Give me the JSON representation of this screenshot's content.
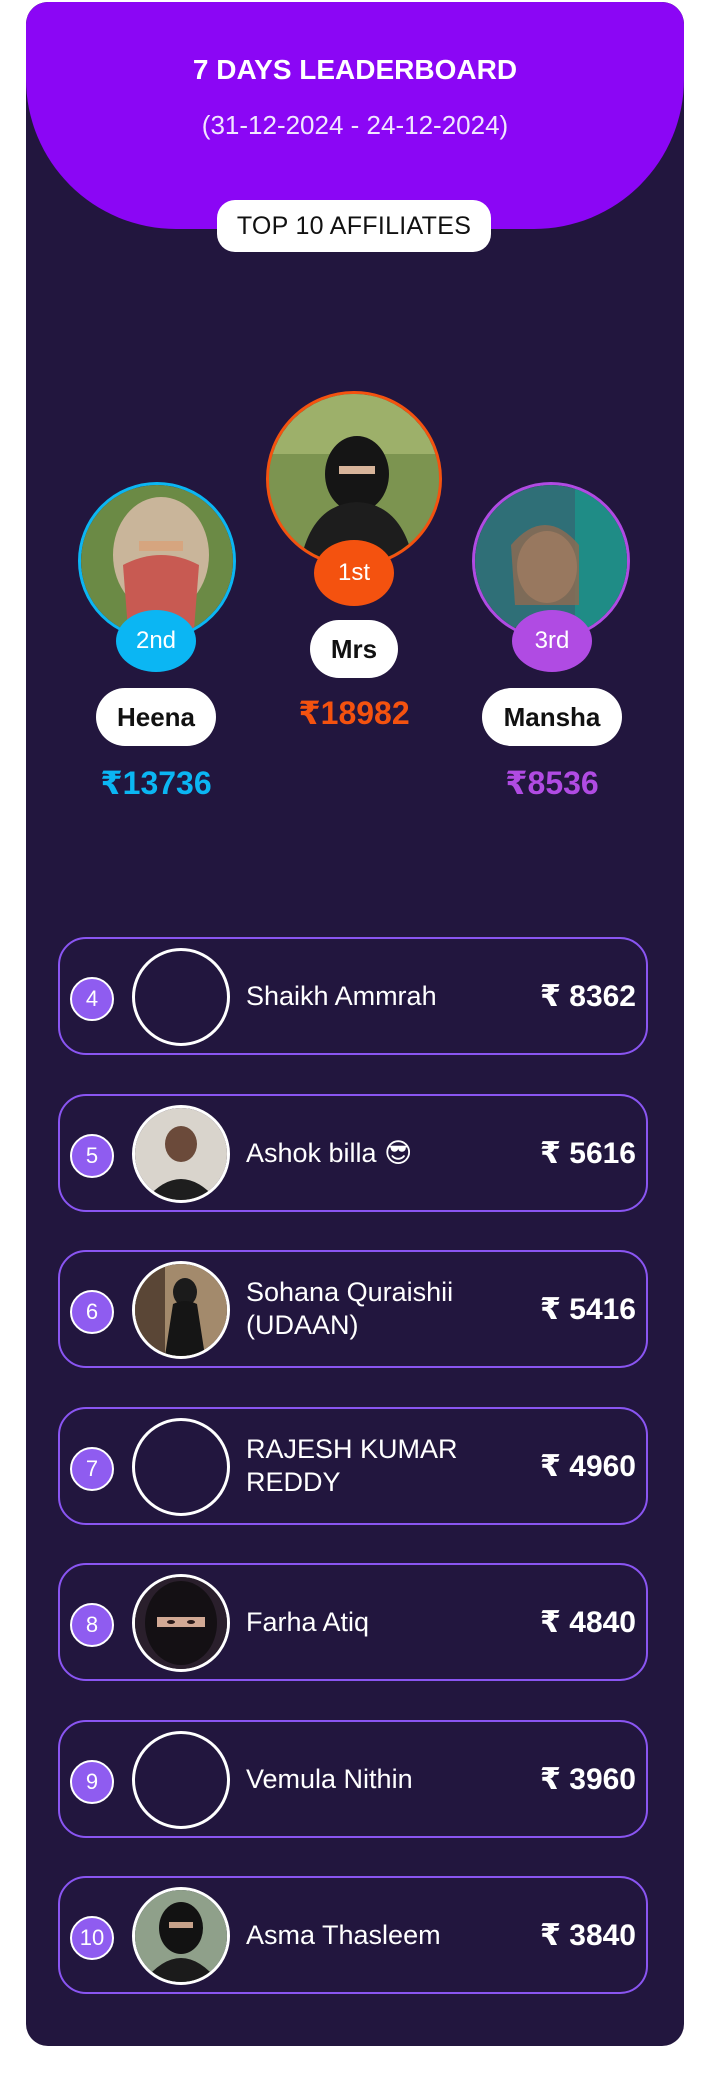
{
  "header": {
    "title": "7 DAYS LEADERBOARD",
    "range": "(31-12-2024 - 24-12-2024)",
    "top_label": "TOP 10 AFFILIATES"
  },
  "podium": {
    "first": {
      "rank": "1st",
      "name": "Mrs",
      "amount": "₹18982",
      "color": "#f4520f"
    },
    "second": {
      "rank": "2nd",
      "name": "Heena",
      "amount": "₹13736",
      "color": "#0bb6f3"
    },
    "third": {
      "rank": "3rd",
      "name": "Mansha",
      "amount": "₹8536",
      "color": "#b04be3"
    }
  },
  "list": [
    {
      "rank": "4",
      "name": "Shaikh Ammrah",
      "amount": "₹ 8362"
    },
    {
      "rank": "5",
      "name": "Ashok billa 😎",
      "amount": "₹ 5616"
    },
    {
      "rank": "6",
      "name": "Sohana Quraishii (UDAAN)",
      "amount": "₹ 5416"
    },
    {
      "rank": "7",
      "name": "RAJESH KUMAR REDDY",
      "amount": "₹ 4960"
    },
    {
      "rank": "8",
      "name": "Farha Atiq",
      "amount": "₹ 4840"
    },
    {
      "rank": "9",
      "name": "Vemula Nithin",
      "amount": "₹ 3960"
    },
    {
      "rank": "10",
      "name": "Asma Thasleem",
      "amount": "₹ 3840"
    }
  ]
}
